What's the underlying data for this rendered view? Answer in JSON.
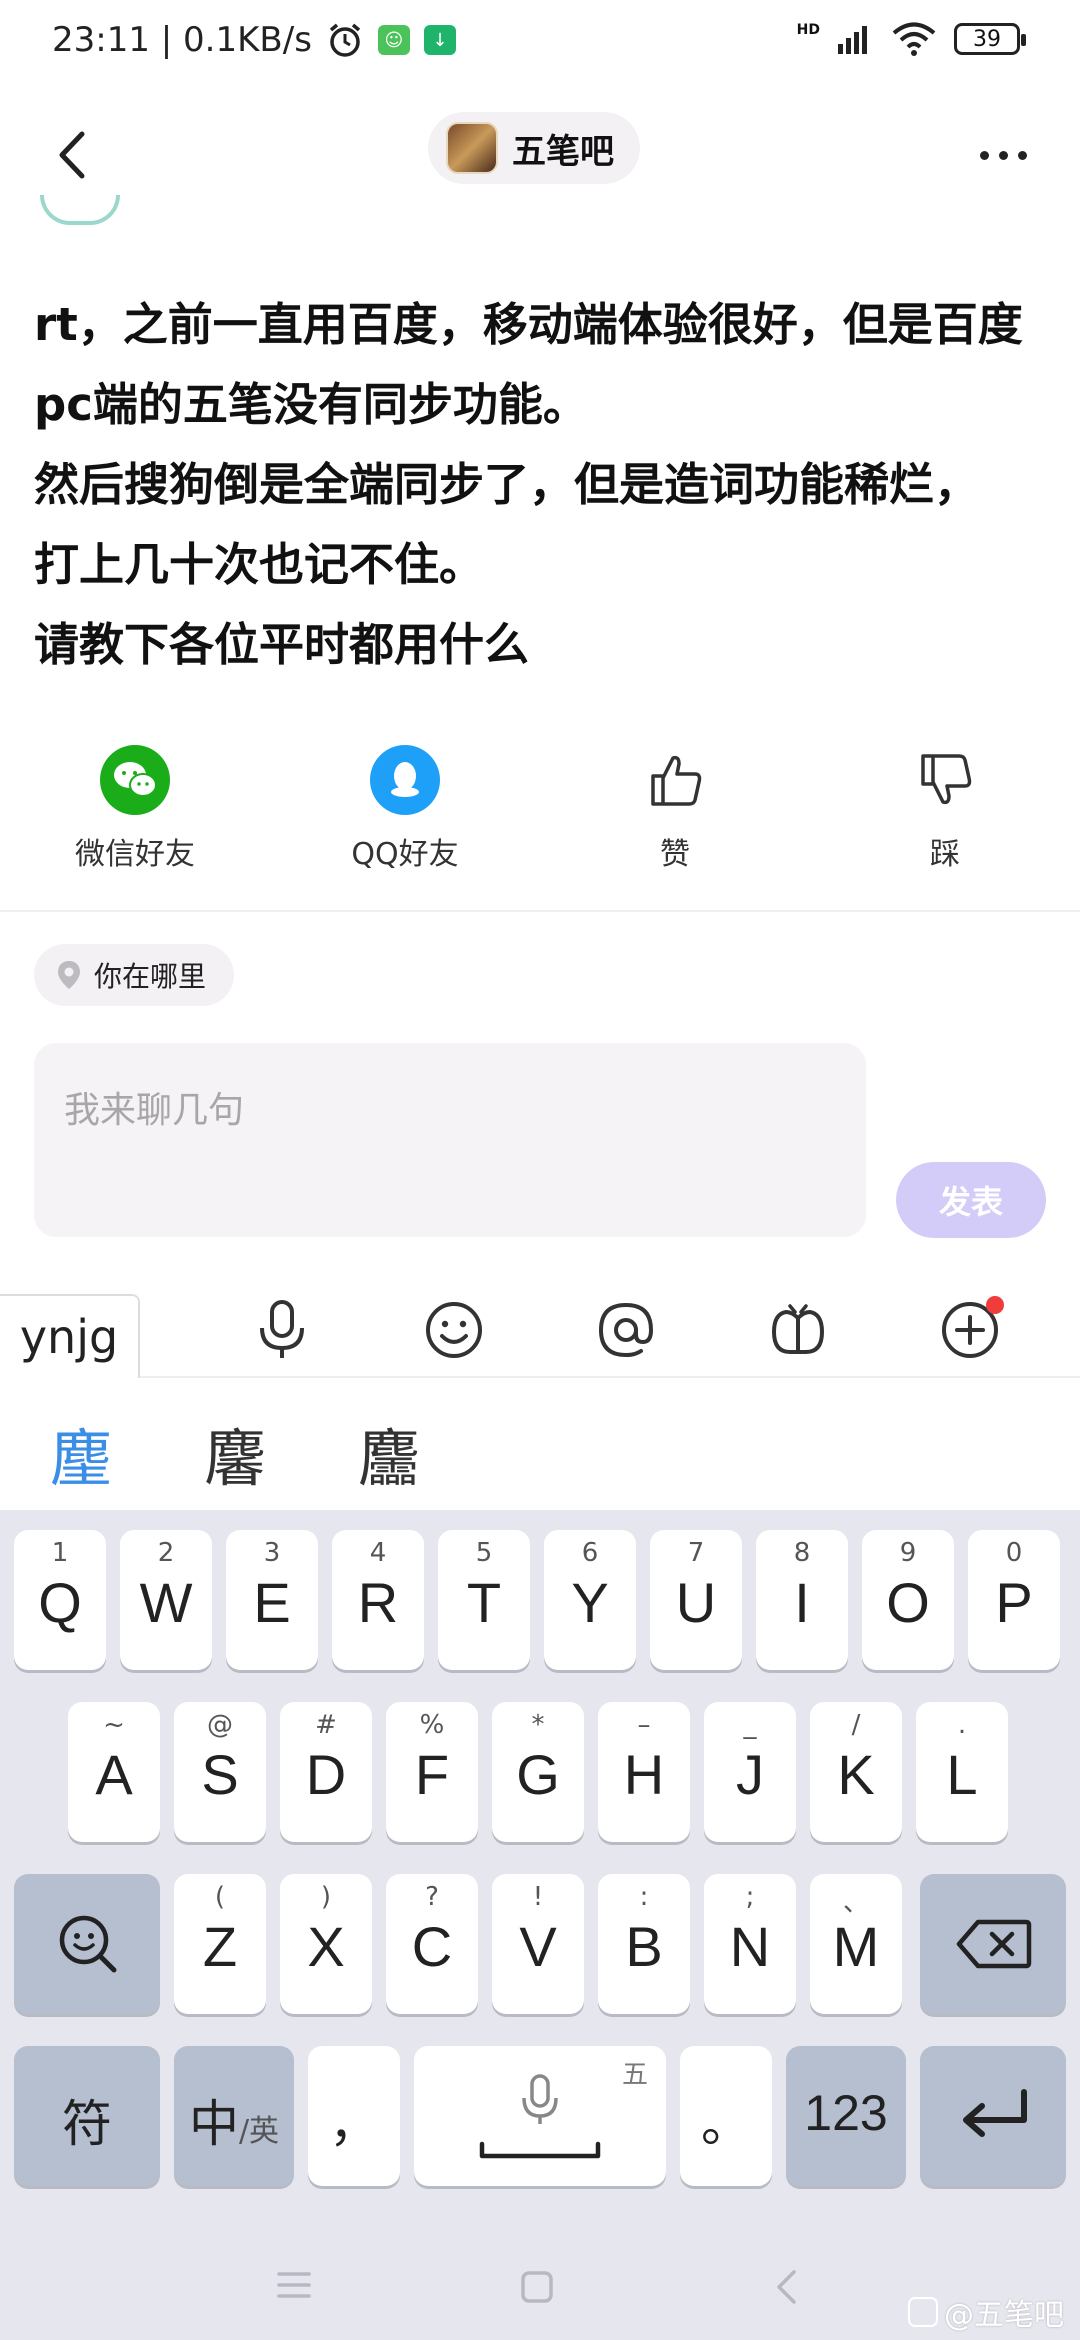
{
  "status_bar": {
    "time_speed": "23:11 | 0.1KB/s",
    "network": "HD",
    "battery": "39"
  },
  "nav": {
    "forum_name": "五笔吧"
  },
  "post": {
    "lines": [
      "rt，之前一直用百度，移动端体验很好，但是百度",
      "pc端的五笔没有同步功能。",
      "然后搜狗倒是全端同步了，但是造词功能稀烂，",
      "打上几十次也记不住。",
      "请教下各位平时都用什么"
    ]
  },
  "share": {
    "wechat": "微信好友",
    "qq": "QQ好友",
    "like": "赞",
    "dislike": "踩"
  },
  "location_chip": "你在哪里",
  "comment": {
    "placeholder": "我来聊几句",
    "send_label": "发表"
  },
  "ime": {
    "composition": "ynjg",
    "candidates": [
      "麈",
      "麘",
      "麢"
    ],
    "row1": [
      {
        "sub": "1",
        "main": "Q"
      },
      {
        "sub": "2",
        "main": "W"
      },
      {
        "sub": "3",
        "main": "E"
      },
      {
        "sub": "4",
        "main": "R"
      },
      {
        "sub": "5",
        "main": "T"
      },
      {
        "sub": "6",
        "main": "Y"
      },
      {
        "sub": "7",
        "main": "U"
      },
      {
        "sub": "8",
        "main": "I"
      },
      {
        "sub": "9",
        "main": "O"
      },
      {
        "sub": "0",
        "main": "P"
      }
    ],
    "row2": [
      {
        "sub": "~",
        "main": "A"
      },
      {
        "sub": "@",
        "main": "S"
      },
      {
        "sub": "#",
        "main": "D"
      },
      {
        "sub": "%",
        "main": "F"
      },
      {
        "sub": "*",
        "main": "G"
      },
      {
        "sub": "–",
        "main": "H"
      },
      {
        "sub": "_",
        "main": "J"
      },
      {
        "sub": "/",
        "main": "K"
      },
      {
        "sub": ".",
        "main": "L"
      }
    ],
    "row3": [
      {
        "sub": "(",
        "main": "Z"
      },
      {
        "sub": ")",
        "main": "X"
      },
      {
        "sub": "?",
        "main": "C"
      },
      {
        "sub": "!",
        "main": "V"
      },
      {
        "sub": ":",
        "main": "B"
      },
      {
        "sub": ";",
        "main": "N"
      },
      {
        "sub": "、",
        "main": "M"
      }
    ],
    "symbols_key": "符",
    "lang_key_main": "中",
    "lang_key_alt": "/英",
    "comma_key": "，",
    "space_hint": "五",
    "period_key": "。",
    "num_key": "123"
  },
  "watermark": "@五笔吧"
}
